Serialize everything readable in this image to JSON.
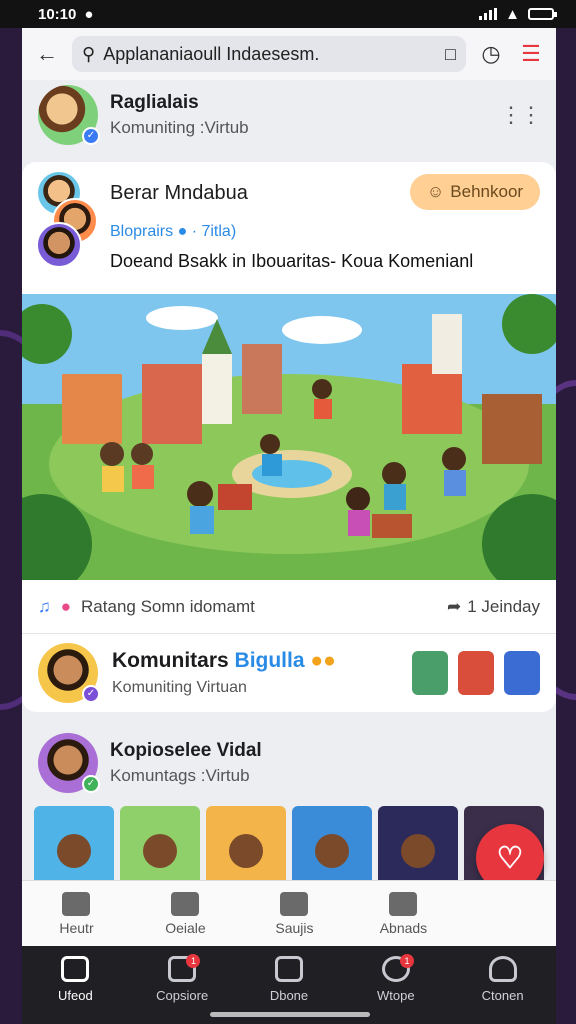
{
  "status": {
    "time": "10:10",
    "time_icon": "camera-icon",
    "signal": "signal-icon",
    "wifi": "wifi-icon",
    "battery": "battery-icon"
  },
  "search": {
    "query": "Applananiaoull Indaesesm.",
    "back_icon": "arrow-left-icon"
  },
  "profile": {
    "name": "Raglialais",
    "subtitle": "Komuniting :Virtub"
  },
  "feature": {
    "title": "Berar Mndabua",
    "meta": "Bloprairs ● · 7itla)",
    "description": "Doeand Bsakk in Ibouaritas- Koua Komenianl",
    "button_label": "Behnkoor"
  },
  "actions": {
    "left_label": "Ratang  Somn idomamt",
    "right_label": "1 Jeinday"
  },
  "community": {
    "title": "Komunitars",
    "accent": "Bigulla",
    "subtitle": "Komuniting Virtuan"
  },
  "virtual": {
    "title": "Kopioselee Vidal",
    "subtitle": "Komuntags :Virtub"
  },
  "sub_nav": [
    {
      "label": "Heutr",
      "icon": "home-icon"
    },
    {
      "label": "Oeiale",
      "icon": "chat-icon"
    },
    {
      "label": "Saujis",
      "icon": "grid-icon"
    },
    {
      "label": "Abnads",
      "icon": "bookmark-icon"
    }
  ],
  "bottom_nav": [
    {
      "label": "Ufeod",
      "icon": "home-icon"
    },
    {
      "label": "Copsiore",
      "icon": "chat-icon",
      "badge": "1"
    },
    {
      "label": "Dbone",
      "icon": "grid-icon"
    },
    {
      "label": "Wtope",
      "icon": "game-icon",
      "badge": "1"
    },
    {
      "label": "Ctonen",
      "icon": "user-icon"
    }
  ],
  "colors": {
    "accent_blue": "#2a8be6",
    "fab_red": "#e8363f",
    "pill_orange": "#ffcf93"
  }
}
